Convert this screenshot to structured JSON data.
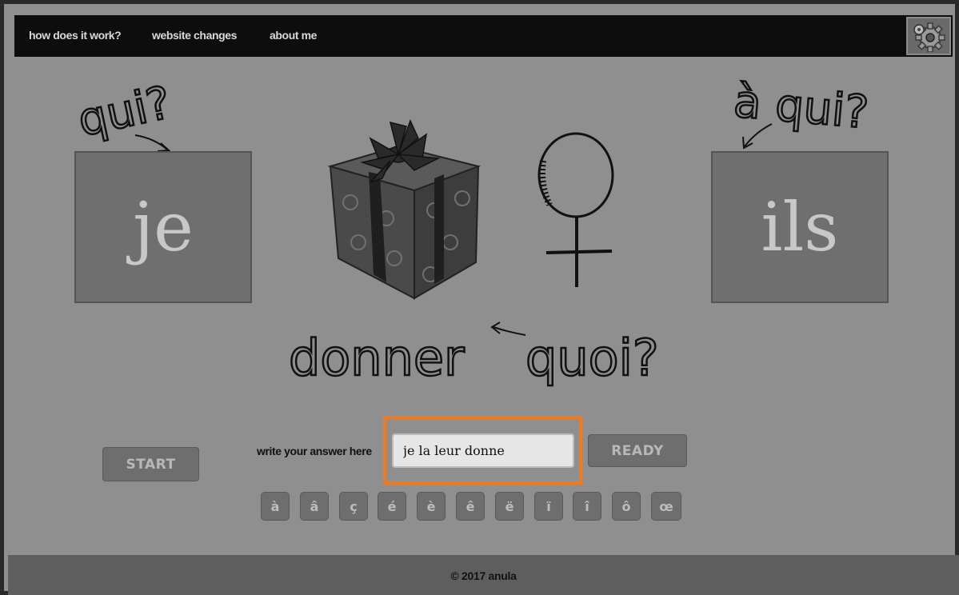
{
  "nav": {
    "links": [
      "how does it work?",
      "website changes",
      "about me"
    ]
  },
  "puzzle": {
    "labels": {
      "who": "qui?",
      "to_whom": "à qui?",
      "verb": "donner",
      "what": "quoi?"
    },
    "subject": "je",
    "indirect_object": "ils"
  },
  "controls": {
    "start_label": "START",
    "answer_label": "write your answer here",
    "answer_value": "je la leur donne",
    "ready_label": "READY",
    "accents": [
      "à",
      "â",
      "ç",
      "é",
      "è",
      "ê",
      "ë",
      "ï",
      "î",
      "ô",
      "œ"
    ]
  },
  "footer": {
    "text": "© 2017 anula"
  },
  "colors": {
    "highlight": "#f07b1e",
    "nav_bg": "#0d0d0d",
    "page_bg": "#8f8f8f"
  }
}
